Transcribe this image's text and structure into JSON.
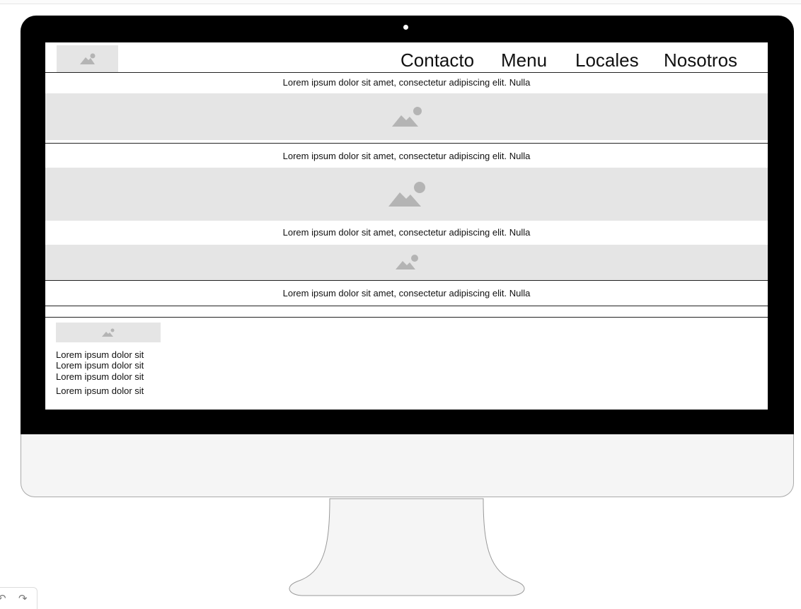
{
  "nav": {
    "items": [
      "Contacto",
      "Menu",
      "Locales",
      "Nosotros"
    ]
  },
  "sections": [
    {
      "text": "Lorem ipsum dolor sit amet, consectetur adipiscing elit. Nulla"
    },
    {
      "text": "Lorem ipsum dolor sit amet, consectetur adipiscing elit. Nulla"
    },
    {
      "text": "Lorem ipsum dolor sit amet, consectetur adipiscing elit. Nulla"
    },
    {
      "text": "Lorem ipsum dolor sit amet, consectetur adipiscing elit. Nulla"
    }
  ],
  "footer": {
    "lines": [
      "Lorem ipsum dolor sit",
      "Lorem ipsum dolor sit",
      "Lorem ipsum dolor sit",
      "Lorem ipsum dolor sit"
    ]
  },
  "corner": {
    "undo_glyph": "↶",
    "redo_glyph": "↷"
  },
  "icons": {
    "placeholder": "image-placeholder-icon",
    "camera": "camera-dot"
  },
  "colors": {
    "bezel": "#000000",
    "placeholder_bg": "#e5e5e5",
    "placeholder_icon": "#b4b4b4",
    "chin": "#f5f5f5"
  }
}
